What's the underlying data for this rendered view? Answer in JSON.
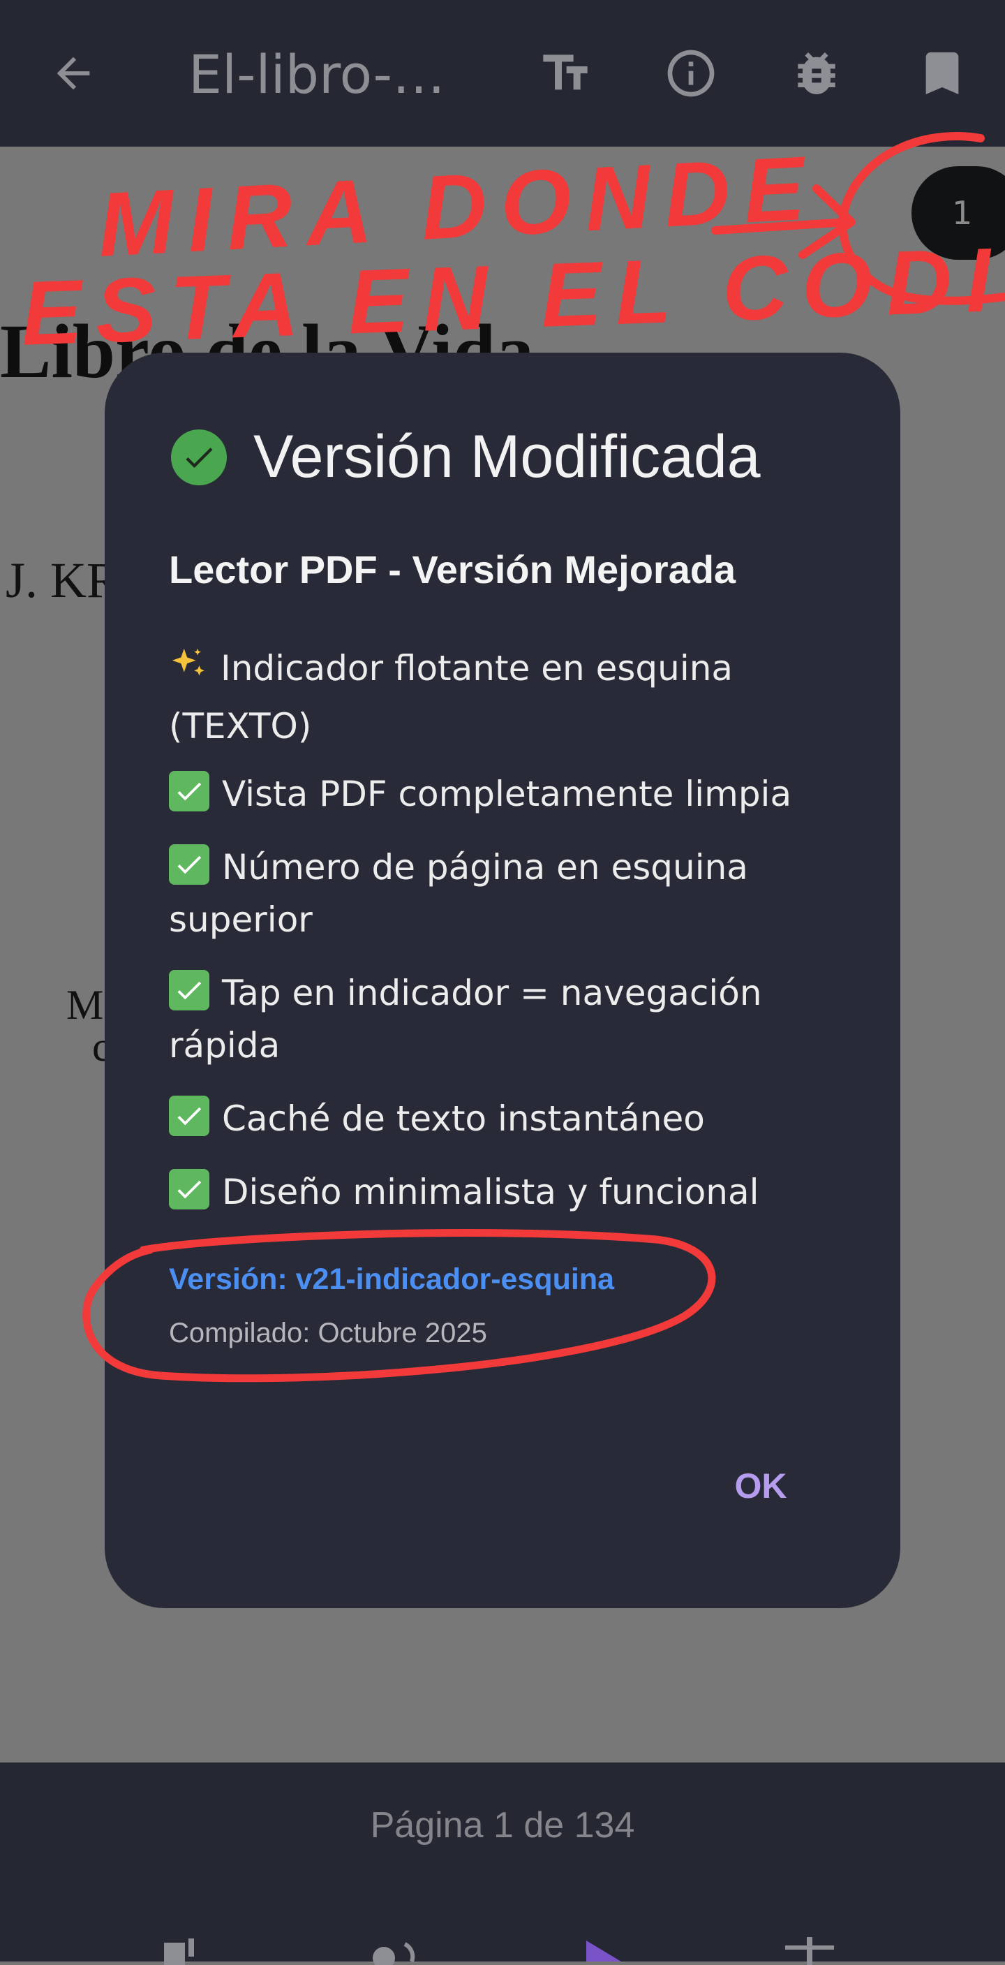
{
  "topbar": {
    "title": "El-libro-de-la-vida",
    "icons": [
      "back-arrow-icon",
      "text-size-icon",
      "info-icon",
      "bug-icon",
      "bookmark-icon"
    ]
  },
  "document": {
    "heading": "Libro de la Vida",
    "author": "J. KR",
    "fragment_1": "M",
    "fragment_2": "c"
  },
  "page_pill": {
    "number": "1"
  },
  "annotation": {
    "line_1": "MIRA DONDE",
    "line_2": "ESTA EN EL CODIGO"
  },
  "dialog": {
    "title": "Versión Modificada",
    "subtitle": "Lector PDF - Versión Mejorada",
    "features": [
      {
        "icon": "sparkles-icon",
        "text": "Indicador flotante en esquina (TEXTO)"
      },
      {
        "icon": "check-box-icon",
        "text": "Vista PDF completamente limpia"
      },
      {
        "icon": "check-box-icon",
        "text": "Número de página en esquina superior"
      },
      {
        "icon": "check-box-icon",
        "text": "Tap en indicador = navegación rápida"
      },
      {
        "icon": "check-box-icon",
        "text": "Caché de texto instantáneo"
      },
      {
        "icon": "check-box-icon",
        "text": "Diseño minimalista y funcional"
      }
    ],
    "version": "Versión: v21-indicador-esquina",
    "compiled": "Compilado: Octubre 2025",
    "ok_label": "OK"
  },
  "bottombar": {
    "page_indicator": "Página 1 de 134"
  },
  "colors": {
    "bar": "#252733",
    "dialog": "#292a37",
    "accent_ok": "#b59cef",
    "version_blue": "#4b8ff2",
    "annotation_red": "#f23a3a"
  }
}
